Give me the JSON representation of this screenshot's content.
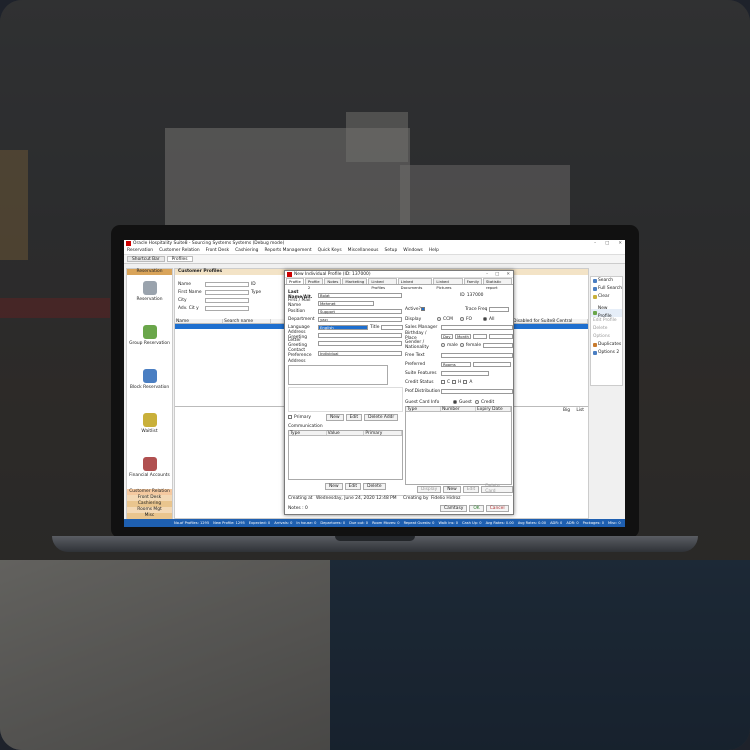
{
  "window": {
    "title": "Oracle Hospitality Suite8 - Sourcing Systems Systems (Debug mode)",
    "controls": [
      "–",
      "□",
      "✕"
    ]
  },
  "menu": [
    "Reservation",
    "Customer Relation",
    "Front Desk",
    "Cashiering",
    "Reports Management",
    "Quick Keys",
    "Miscellaneous",
    "Setup",
    "Windows",
    "Help"
  ],
  "tabs": [
    "Shortcut Bar",
    "Profiles"
  ],
  "leftnav": {
    "header": "Reservation",
    "items": [
      {
        "label": "Reservation",
        "icon": "key-icon",
        "color": "#9aa3ad"
      },
      {
        "label": "Group Reservation",
        "icon": "group-icon",
        "color": "#6aa64a"
      },
      {
        "label": "Block Reservation",
        "icon": "block-icon",
        "color": "#4a7ec2"
      },
      {
        "label": "Waitlist",
        "icon": "waitlist-icon",
        "color": "#c9b03a"
      },
      {
        "label": "Financial Accounts",
        "icon": "accounts-icon",
        "color": "#b05050"
      }
    ],
    "footer": [
      "Customer Relation",
      "Front Desk",
      "Cashiering",
      "Rooms Mgt",
      "Misc"
    ]
  },
  "customer_profiles": {
    "header": "Customer Profiles",
    "labels": {
      "name": "Name",
      "firstname": "First Name",
      "city": "City",
      "adv": "Adv. Cit y",
      "id": "ID",
      "type": "Type"
    },
    "grid_columns": [
      "Name",
      "Search name",
      "",
      "",
      "",
      "",
      "Remote link",
      "Disabled for Suite8 Central"
    ]
  },
  "rightbar": [
    {
      "label": "Search",
      "icon": "search-icon",
      "disabled": false
    },
    {
      "label": "Full Search",
      "icon": "search-icon",
      "disabled": false
    },
    {
      "label": "Clear",
      "icon": "clear-icon",
      "disabled": false
    },
    {
      "label": "New Profile",
      "icon": "new-icon",
      "disabled": false
    },
    {
      "label": "Edit Profile",
      "icon": "edit-icon",
      "disabled": true
    },
    {
      "label": "Delete",
      "icon": "delete-icon",
      "disabled": true
    },
    {
      "label": "Options",
      "icon": "options-icon",
      "disabled": true
    },
    {
      "label": "Duplicates",
      "icon": "duplicates-icon",
      "disabled": false
    },
    {
      "label": "Options 2",
      "icon": "options-icon",
      "disabled": false
    }
  ],
  "lower_controls": {
    "big": "Big",
    "list": "List"
  },
  "statusbar": [
    "No.of Profiles: 1295",
    "New Profile: 1295",
    "Expected: 0",
    "Arrivals: 0",
    "In house: 0",
    "Departures: 0",
    "Due out: 0",
    "Room Moves: 0",
    "Repeat Guests: 0",
    "Walk ins: 0",
    "Cash Up: 0",
    "Avg Rates: 0.00",
    "Avg Rates: 0.00",
    "ADR: 0",
    "ADR: 0",
    "Packages: 0",
    "Misc: 0"
  ],
  "dialog": {
    "title": "New Individual Profile (ID: 137000)",
    "tabs": [
      "Profile",
      "Profile 2",
      "Notes",
      "Marketing",
      "Linked Profiles",
      "Linked Documents",
      "Linked Pictures",
      "Family",
      "Statistic report"
    ],
    "fields": {
      "last_name": {
        "label": "Last Name/Alt.",
        "value": "Bolat"
      },
      "first_name": {
        "label": "First / Mail Name",
        "value": "Mehmet"
      },
      "position": {
        "label": "Position",
        "value": "Support"
      },
      "department": {
        "label": "Department",
        "value": "yazı"
      },
      "language": {
        "label": "Language",
        "value": "English"
      },
      "title": {
        "label": "Title",
        "value": ""
      },
      "address_greeting": {
        "label": "Address Greeting",
        "value": ""
      },
      "letter_greeting": {
        "label": "Letter Greeting",
        "value": ""
      },
      "contact_pref": {
        "label": "Contact Preference",
        "value": "Individual"
      },
      "address": {
        "label": "Address",
        "value": ""
      },
      "id": {
        "label": "ID",
        "value": "137000"
      },
      "active": {
        "label": "Active?",
        "checked": true
      },
      "trace_freq": {
        "label": "Trace Freq",
        "value": ""
      },
      "display": {
        "label": "Display",
        "options": [
          "CCM",
          "FO",
          "All"
        ],
        "selected": "All"
      },
      "sales_manager": {
        "label": "Sales Manager",
        "value": ""
      },
      "birthday": {
        "label": "Birthday / Place",
        "day": "Day",
        "month": "Month",
        "year": ""
      },
      "gender": {
        "label": "Gender / Nationality",
        "options": [
          "male",
          "female"
        ]
      },
      "free_text": {
        "label": "Free Text",
        "value": ""
      },
      "preferred": {
        "label": "Preferred",
        "value": "Rooms"
      },
      "suite_features": {
        "label": "Suite Features",
        "value": ""
      },
      "credit_status": {
        "label": "Credit Status",
        "options": [
          "C",
          "H",
          "A"
        ]
      },
      "prof_distribution": {
        "label": "Prof.Distribution",
        "value": ""
      },
      "guest_card": {
        "label": "Guest Card Info",
        "options": [
          "Guest",
          "Credit"
        ]
      }
    },
    "primary_label": "Primary",
    "communication_label": "Communication",
    "comm_columns": [
      "Type",
      "Value",
      "Primary"
    ],
    "card_columns": [
      "Type",
      "Number",
      "Expiry Date"
    ],
    "address_buttons": [
      "New",
      "Edit",
      "Delete Addr"
    ],
    "comm_buttons": [
      "New",
      "Edit",
      "Delete"
    ],
    "card_buttons": [
      "Display",
      "New",
      "Edit",
      "Delete Card"
    ],
    "created": {
      "label": "Creating at",
      "value": "Wednesday, June 24, 2020 12:48 PM",
      "by_label": "Creating by",
      "by": "Fidelio Hidroz"
    },
    "notes": "Notes : 0",
    "footer_buttons": [
      "Camtasy",
      "OK",
      "Cancel"
    ]
  }
}
